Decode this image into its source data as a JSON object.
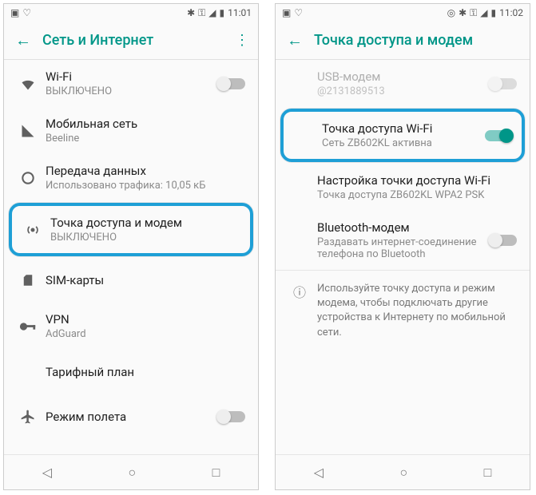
{
  "left": {
    "status": {
      "time": "11:01"
    },
    "title": "Сеть и Интернет",
    "items": [
      {
        "title": "Wi-Fi",
        "sub": "ВЫКЛЮЧЕНО"
      },
      {
        "title": "Мобильная сеть",
        "sub": "Beeline"
      },
      {
        "title": "Передача данных",
        "sub": "Использовано трафика: 10,05 кБ"
      },
      {
        "title": "Точка доступа и модем",
        "sub": "ВЫКЛЮЧЕНО"
      },
      {
        "title": "SIM-карты",
        "sub": ""
      },
      {
        "title": "VPN",
        "sub": "AdGuard"
      },
      {
        "title": "Тарифный план",
        "sub": ""
      },
      {
        "title": "Режим полета",
        "sub": ""
      }
    ]
  },
  "right": {
    "status": {
      "time": "11:02"
    },
    "title": "Точка доступа и модем",
    "items": [
      {
        "title": "USB-модем",
        "sub": "@2131889513"
      },
      {
        "title": "Точка доступа Wi-Fi",
        "sub": "Сеть ZB602KL активна"
      },
      {
        "title": "Настройка точки доступа Wi-Fi",
        "sub": "Точка доступа ZB602KL WPA2 PSK"
      },
      {
        "title": "Bluetooth-модем",
        "sub": "Раздавать интернет-соединение телефона по Bluetooth"
      }
    ],
    "info": "Используйте точку доступа и режим модема, чтобы подключать другие устройства к Интернету по мобильной сети."
  }
}
